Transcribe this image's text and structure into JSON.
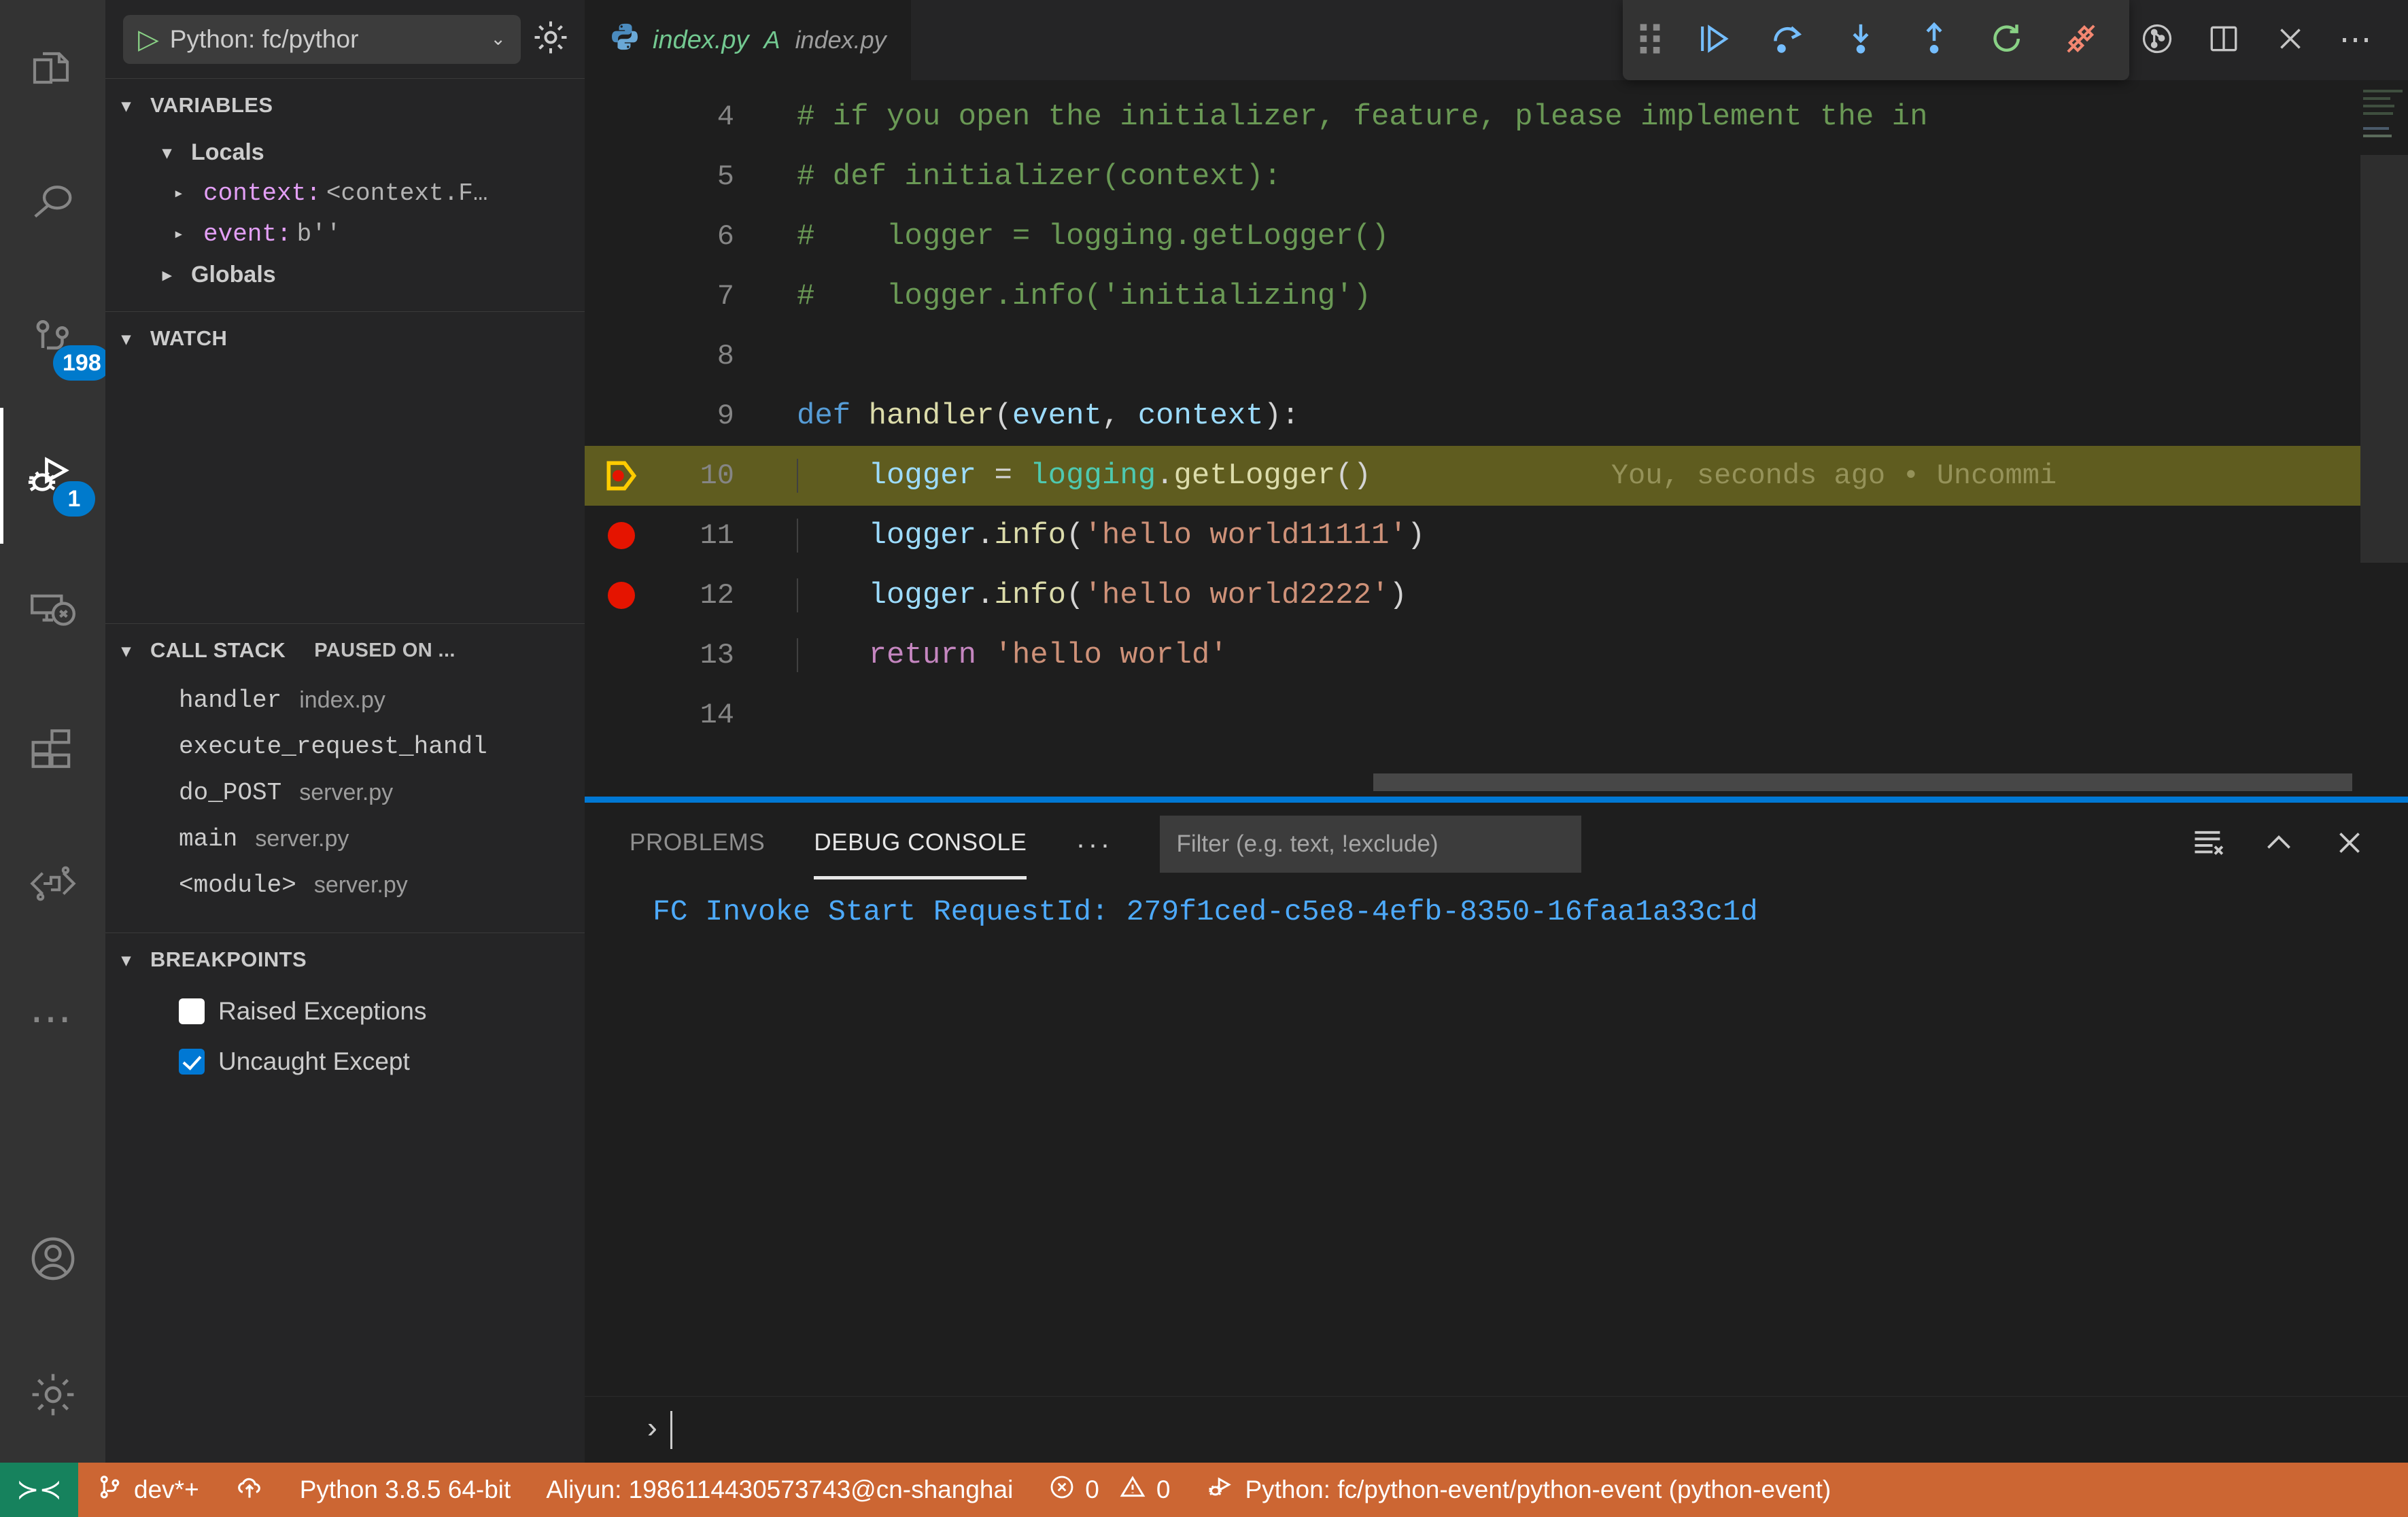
{
  "activitybar": {
    "items": [
      {
        "name": "explorer",
        "icon": "files-icon",
        "badge": null,
        "active": false
      },
      {
        "name": "search",
        "icon": "search-icon",
        "badge": null,
        "active": false
      },
      {
        "name": "source-control",
        "icon": "source-control-icon",
        "badge": "198",
        "active": false
      },
      {
        "name": "run-and-debug",
        "icon": "run-debug-icon",
        "badge": "1",
        "active": true
      },
      {
        "name": "remote-explorer",
        "icon": "remote-explorer-icon",
        "badge": null,
        "active": false
      },
      {
        "name": "extensions",
        "icon": "extensions-icon",
        "badge": null,
        "active": false
      },
      {
        "name": "serverless-devs",
        "icon": "serverless-icon",
        "badge": null,
        "active": false
      },
      {
        "name": "more-views",
        "icon": "ellipsis-icon",
        "badge": null,
        "active": false
      }
    ],
    "bottom": [
      {
        "name": "accounts",
        "icon": "account-icon"
      },
      {
        "name": "manage",
        "icon": "gear-icon"
      }
    ]
  },
  "sidebar": {
    "run_config": {
      "label": "Python: fc/pythor",
      "chevron": "⌄",
      "play_glyph": "▷"
    },
    "variables": {
      "title": "VARIABLES",
      "locals_title": "Locals",
      "globals_title": "Globals",
      "locals": [
        {
          "name": "context:",
          "value": "<context.F…"
        },
        {
          "name": "event:",
          "value": "b''"
        }
      ]
    },
    "watch": {
      "title": "WATCH",
      "items": []
    },
    "callstack": {
      "title": "CALL STACK",
      "state": "PAUSED ON ...",
      "frames": [
        {
          "fn": "handler",
          "file": "index.py"
        },
        {
          "fn": "execute_request_handl",
          "file": ""
        },
        {
          "fn": "do_POST",
          "file": "server.py"
        },
        {
          "fn": "main",
          "file": "server.py"
        },
        {
          "fn": "<module>",
          "file": "server.py"
        }
      ]
    },
    "breakpoints": {
      "title": "BREAKPOINTS",
      "items": [
        {
          "label": "Raised Exceptions",
          "checked": false
        },
        {
          "label": "Uncaught Except",
          "checked": true
        }
      ]
    }
  },
  "editor": {
    "tab": {
      "filename": "index.py",
      "badge": "A",
      "description": "index.py",
      "icon": "python-icon"
    },
    "actions": [
      {
        "name": "run-python-file",
        "icon": "play-icon",
        "color": "#89d185"
      },
      {
        "name": "timeline-history",
        "icon": "history-icon",
        "color": "#c5c5c5"
      },
      {
        "name": "compare-changes",
        "icon": "compare-icon",
        "color": "#c5c5c5"
      },
      {
        "name": "previous-change",
        "icon": "go-previous-change-icon",
        "color": "#c5c5c5"
      },
      {
        "name": "current-change",
        "icon": "current-change-icon",
        "color": "#8a8a8a"
      },
      {
        "name": "next-change",
        "icon": "go-next-change-icon",
        "color": "#8a8a8a"
      },
      {
        "name": "git-graph",
        "icon": "git-graph-icon",
        "color": "#c5c5c5"
      },
      {
        "name": "split-editor",
        "icon": "split-editor-icon",
        "color": "#c5c5c5"
      },
      {
        "name": "close-editor",
        "icon": "close-icon",
        "color": "#c5c5c5"
      },
      {
        "name": "more-actions",
        "icon": "ellipsis-icon",
        "color": "#c5c5c5"
      }
    ],
    "debug_toolbar": [
      {
        "name": "drag-handle",
        "icon": "grip-icon"
      },
      {
        "name": "continue",
        "icon": "continue-icon"
      },
      {
        "name": "step-over",
        "icon": "step-over-icon"
      },
      {
        "name": "step-into",
        "icon": "step-into-icon"
      },
      {
        "name": "step-out",
        "icon": "step-out-icon"
      },
      {
        "name": "restart",
        "icon": "restart-icon"
      },
      {
        "name": "disconnect",
        "icon": "disconnect-icon"
      }
    ],
    "blame_annotation": "You, seconds ago • Uncommi",
    "lines": [
      {
        "num": "4",
        "glyph": "",
        "segments": [
          {
            "t": "# if you open the initializer, feature, please implement the in",
            "c": "tok-comment"
          }
        ]
      },
      {
        "num": "5",
        "glyph": "",
        "segments": [
          {
            "t": "# def initializer(context):",
            "c": "tok-comment"
          }
        ]
      },
      {
        "num": "6",
        "glyph": "",
        "segments": [
          {
            "t": "#    logger = logging.getLogger()",
            "c": "tok-comment"
          }
        ]
      },
      {
        "num": "7",
        "glyph": "",
        "segments": [
          {
            "t": "#    logger.info('initializing')",
            "c": "tok-comment"
          }
        ]
      },
      {
        "num": "8",
        "glyph": "",
        "segments": []
      },
      {
        "num": "9",
        "glyph": "",
        "segments": [
          {
            "t": "def ",
            "c": "tok-kw"
          },
          {
            "t": "handler",
            "c": "tok-fn"
          },
          {
            "t": "(",
            "c": "tok-plain"
          },
          {
            "t": "event",
            "c": "tok-var"
          },
          {
            "t": ", ",
            "c": "tok-plain"
          },
          {
            "t": "context",
            "c": "tok-var"
          },
          {
            "t": "):",
            "c": "tok-plain"
          }
        ]
      },
      {
        "num": "10",
        "glyph": "current-breakpoint",
        "current": true,
        "segments": [
          {
            "t": "    ",
            "c": "tok-plain"
          },
          {
            "t": "logger",
            "c": "tok-var"
          },
          {
            "t": " = ",
            "c": "tok-plain"
          },
          {
            "t": "logging",
            "c": "tok-type"
          },
          {
            "t": ".",
            "c": "tok-dot"
          },
          {
            "t": "getLogger",
            "c": "tok-fn"
          },
          {
            "t": "()",
            "c": "tok-plain"
          }
        ]
      },
      {
        "num": "11",
        "glyph": "breakpoint",
        "segments": [
          {
            "t": "    ",
            "c": "tok-plain"
          },
          {
            "t": "logger",
            "c": "tok-var"
          },
          {
            "t": ".",
            "c": "tok-dot"
          },
          {
            "t": "info",
            "c": "tok-fn"
          },
          {
            "t": "(",
            "c": "tok-plain"
          },
          {
            "t": "'hello world11111'",
            "c": "tok-str"
          },
          {
            "t": ")",
            "c": "tok-plain"
          }
        ]
      },
      {
        "num": "12",
        "glyph": "breakpoint",
        "segments": [
          {
            "t": "    ",
            "c": "tok-plain"
          },
          {
            "t": "logger",
            "c": "tok-var"
          },
          {
            "t": ".",
            "c": "tok-dot"
          },
          {
            "t": "info",
            "c": "tok-fn"
          },
          {
            "t": "(",
            "c": "tok-plain"
          },
          {
            "t": "'hello world2222'",
            "c": "tok-str"
          },
          {
            "t": ")",
            "c": "tok-plain"
          }
        ]
      },
      {
        "num": "13",
        "glyph": "",
        "segments": [
          {
            "t": "    ",
            "c": "tok-plain"
          },
          {
            "t": "return",
            "c": "tok-kw2"
          },
          {
            "t": " ",
            "c": "tok-plain"
          },
          {
            "t": "'hello world'",
            "c": "tok-str"
          }
        ]
      },
      {
        "num": "14",
        "glyph": "",
        "segments": []
      }
    ]
  },
  "panel": {
    "tabs": [
      {
        "label": "PROBLEMS",
        "active": false
      },
      {
        "label": "DEBUG CONSOLE",
        "active": true
      }
    ],
    "more_label": "···",
    "filter": {
      "value": "",
      "placeholder": "Filter (e.g. text, !exclude)"
    },
    "actions": [
      {
        "name": "clear-console",
        "icon": "clear-console-icon"
      },
      {
        "name": "collapse-panel",
        "icon": "chevron-up-icon"
      },
      {
        "name": "close-panel",
        "icon": "close-icon"
      }
    ],
    "output": [
      "FC Invoke Start RequestId: 279f1ced-c5e8-4efb-8350-16faa1a33c1d"
    ],
    "prompt": "›"
  },
  "statusbar": {
    "remote_glyph": "≻≺",
    "branch": "dev*+",
    "sync_icon": "cloud-upload-icon",
    "python_version": "Python 3.8.5 64-bit",
    "aliyun": "Aliyun: 1986114430573743@cn-shanghai",
    "errors": "0",
    "warnings": "0",
    "debug_target": "Python: fc/python-event/python-event (python-event)"
  },
  "colors": {
    "statusbar_debug": "#cc6633",
    "remote_green": "#16825d",
    "accent_blue": "#0078d4",
    "badge_blue": "#007acc",
    "breakpoint_red": "#e51400",
    "current_line": "#5f5c1f"
  }
}
